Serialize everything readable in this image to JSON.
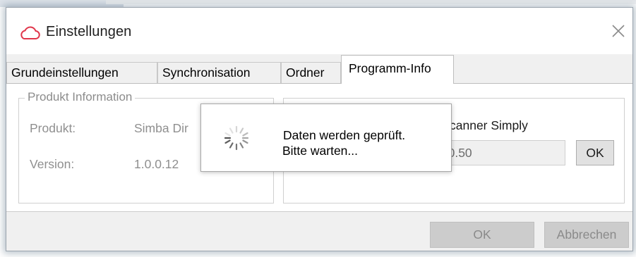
{
  "window": {
    "title": "Einstellungen",
    "icon": "cloud-outline-icon",
    "close_icon": "close-icon",
    "accent_color": "#e0354a"
  },
  "tabs": [
    {
      "label": "Grundeinstellungen",
      "active": false
    },
    {
      "label": "Synchronisation",
      "active": false
    },
    {
      "label": "Ordner",
      "active": false
    },
    {
      "label": "Programm-Info",
      "active": true
    }
  ],
  "product_info": {
    "group_title": "Produkt Information",
    "product_label": "Produkt:",
    "product_value": "Simba Dir",
    "version_label": "Version:",
    "version_value": "1.0.0.12"
  },
  "update_section": {
    "title_fragment": "canner Simply",
    "version_field_value": "3.0.50",
    "ok_label": "OK"
  },
  "loading": {
    "spinner_icon": "spinner-icon",
    "line1": "Daten werden geprüft.",
    "line2": "Bitte warten..."
  },
  "footer": {
    "ok_label": "OK",
    "cancel_label": "Abbrechen",
    "buttons_enabled": false
  }
}
